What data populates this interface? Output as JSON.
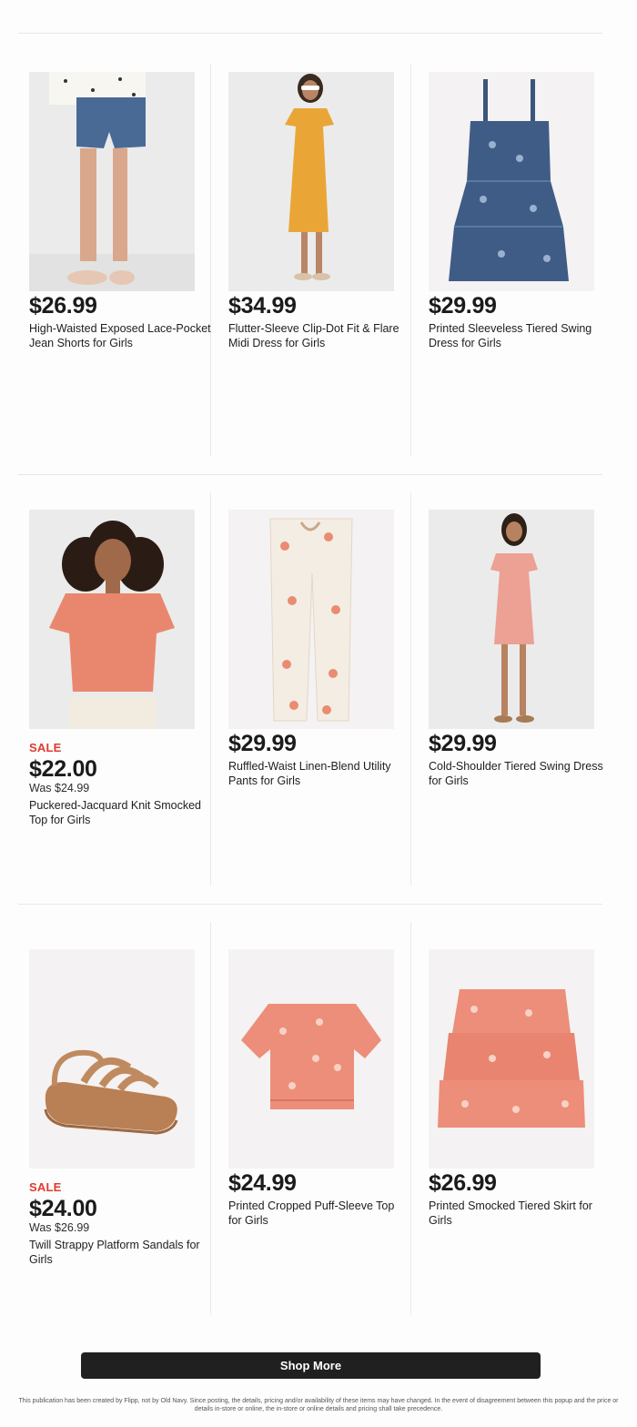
{
  "products": [
    {
      "sale": "",
      "price": "$26.99",
      "was": "",
      "title": "High-Waisted Exposed Lace-Pocket Jean Shorts for Girls",
      "icon": "jean-shorts"
    },
    {
      "sale": "",
      "price": "$34.99",
      "was": "",
      "title": "Flutter-Sleeve Clip-Dot Fit & Flare Midi Dress for Girls",
      "icon": "yellow-dress"
    },
    {
      "sale": "",
      "price": "$29.99",
      "was": "",
      "title": "Printed Sleeveless Tiered Swing Dress for Girls",
      "icon": "blue-dress"
    },
    {
      "sale": "SALE",
      "price": "$22.00",
      "was": "Was $24.99",
      "title": "Puckered-Jacquard Knit Smocked Top for Girls",
      "icon": "pink-top"
    },
    {
      "sale": "",
      "price": "$29.99",
      "was": "",
      "title": "Ruffled-Waist Linen-Blend Utility Pants for Girls",
      "icon": "floral-pants"
    },
    {
      "sale": "",
      "price": "$29.99",
      "was": "",
      "title": "Cold-Shoulder Tiered Swing Dress for Girls",
      "icon": "pink-dress"
    },
    {
      "sale": "SALE",
      "price": "$24.00",
      "was": "Was $26.99",
      "title": "Twill Strappy Platform Sandals for Girls",
      "icon": "sandal"
    },
    {
      "sale": "",
      "price": "$24.99",
      "was": "",
      "title": "Printed Cropped Puff-Sleeve Top for Girls",
      "icon": "cropped-top"
    },
    {
      "sale": "",
      "price": "$26.99",
      "was": "",
      "title": "Printed Smocked Tiered Skirt for Girls",
      "icon": "tiered-skirt"
    }
  ],
  "shop_more_label": "Shop More",
  "disclaimer": "This publication has been created by Flipp, not by Old Navy. Since posting, the details, pricing and/or availability of these items may have changed. In the event of disagreement between this popup and the price or details in-store or online, the in-store or online details and pricing shall take precedence.",
  "colors": {
    "sale": "#e03a2f",
    "button": "#202020"
  }
}
